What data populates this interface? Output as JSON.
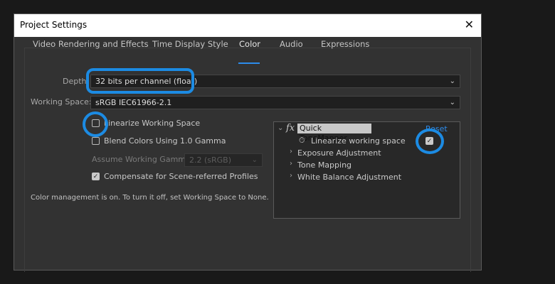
{
  "dialog": {
    "title": "Project Settings",
    "close_glyph": "✕"
  },
  "tabs": [
    {
      "label": "Video Rendering and Effects"
    },
    {
      "label": "Time Display Style"
    },
    {
      "label": "Color",
      "active": true
    },
    {
      "label": "Audio"
    },
    {
      "label": "Expressions"
    }
  ],
  "color": {
    "depth_label": "Depth:",
    "depth_value": "32 bits per channel (float)",
    "working_space_label": "Working Space:",
    "working_space_value": "sRGB IEC61966-2.1",
    "linearize_label": "Linearize Working Space",
    "linearize_checked": false,
    "blend_label": "Blend Colors Using 1.0 Gamma",
    "blend_checked": false,
    "assume_gamma_label": "Assume Working Gamma:",
    "assume_gamma_value": "2.2 (sRGB)",
    "compensate_label": "Compensate for Scene-referred Profiles",
    "compensate_checked": true,
    "info": "Color management is on. To turn it off, set Working Space to None."
  },
  "effect": {
    "fx_symbol": "fx",
    "name": "Quick ToneMapper",
    "reset": "Reset",
    "linearize_label": "Linearize working space",
    "linearize_checked": true,
    "groups": [
      {
        "label": "Exposure Adjustment"
      },
      {
        "label": "Tone Mapping"
      },
      {
        "label": "White Balance Adjustment"
      }
    ]
  },
  "glyphs": {
    "chevron_down": "⌄",
    "chevron_right": "›",
    "check": "✓",
    "stopwatch": "⏱"
  },
  "colors": {
    "accent": "#1c8be3",
    "dialog_bg": "#323232",
    "overlay_bg": "#282828"
  }
}
